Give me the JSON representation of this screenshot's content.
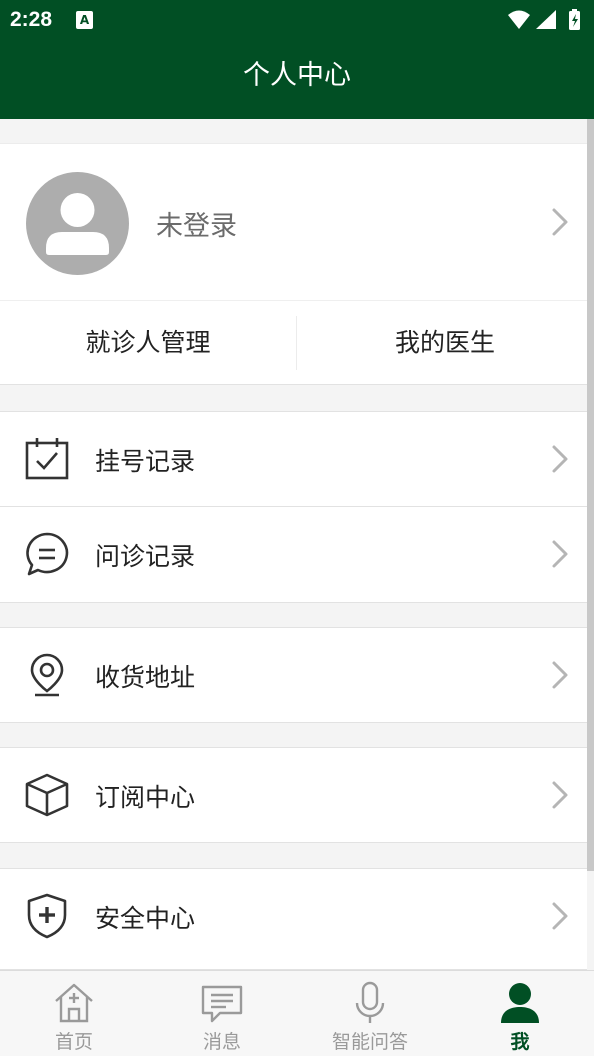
{
  "status_bar": {
    "time": "2:28",
    "notification_icon": "A"
  },
  "header": {
    "title": "个人中心"
  },
  "profile": {
    "login_text": "未登录",
    "patient_management_label": "就诊人管理",
    "my_doctor_label": "我的医生"
  },
  "menu": {
    "items": [
      {
        "label": "挂号记录",
        "icon": "calendar-check-icon"
      },
      {
        "label": "问诊记录",
        "icon": "chat-bubble-icon"
      },
      {
        "label": "收货地址",
        "icon": "location-pin-icon"
      },
      {
        "label": "订阅中心",
        "icon": "box-icon"
      },
      {
        "label": "安全中心",
        "icon": "shield-plus-icon"
      }
    ]
  },
  "tabs": [
    {
      "label": "首页",
      "icon": "home-icon",
      "active": false
    },
    {
      "label": "消息",
      "icon": "message-icon",
      "active": false
    },
    {
      "label": "智能问答",
      "icon": "microphone-icon",
      "active": false
    },
    {
      "label": "我",
      "icon": "person-icon",
      "active": true
    }
  ],
  "colors": {
    "brand": "#014f24",
    "inactive_tab": "#9a9a9a",
    "background": "#f4f4f4"
  }
}
